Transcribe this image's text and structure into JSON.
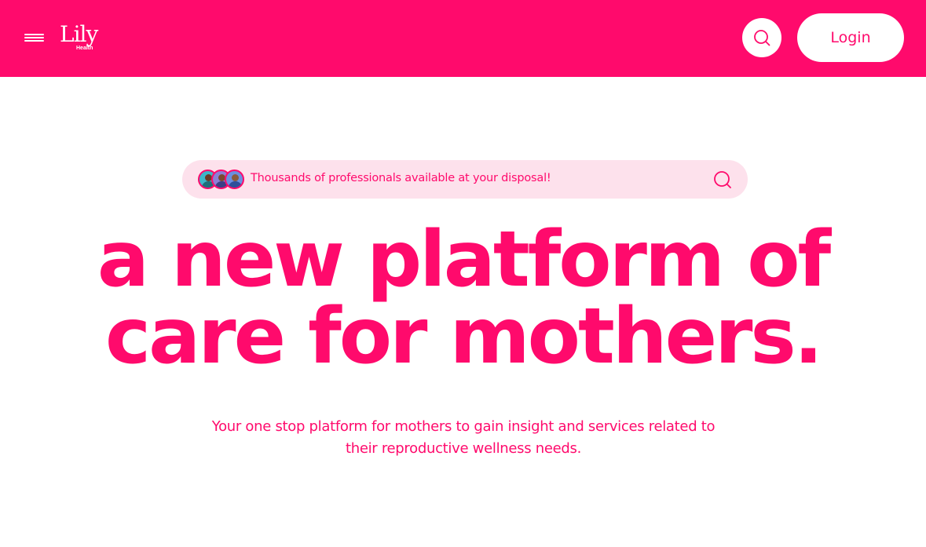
{
  "brand": {
    "logo_word": "Lily",
    "logo_sub": "Health",
    "primary_color": "#ff0a6c",
    "pill_bg_color": "#fde1ec"
  },
  "header": {
    "menu_icon": "hamburger-icon",
    "search_icon": "search-icon",
    "login_label": "Login"
  },
  "hero": {
    "banner_text": "Thousands of professionals available at your disposal!",
    "banner_search_icon": "search-icon",
    "avatars": [
      "avatar-professional-1",
      "avatar-professional-2",
      "avatar-professional-3"
    ],
    "headline_line1": "a new platform of",
    "headline_line2": "care for mothers.",
    "subtext": "Your one stop platform for mothers to gain insight and services related to their reproductive wellness needs."
  }
}
